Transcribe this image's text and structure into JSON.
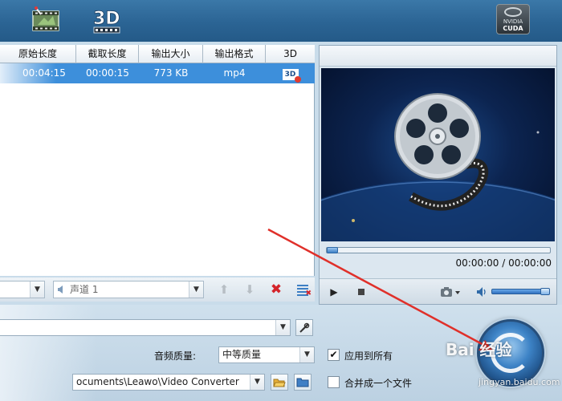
{
  "toolbar": {
    "edit_icon": "film-edit-icon",
    "threed_label": "3D",
    "nvidia": {
      "brand": "NVIDIA",
      "label": "CUDA"
    }
  },
  "file_list": {
    "columns": [
      "原始长度",
      "截取长度",
      "输出大小",
      "输出格式",
      "3D"
    ],
    "rows": [
      {
        "original_length": "00:04:15",
        "trim_length": "00:00:15",
        "output_size": "773 KB",
        "output_format": "mp4",
        "threed_icon": "3d-badge-icon"
      }
    ]
  },
  "list_tools": {
    "audio_track": "声道 1",
    "icons": [
      "move-up-icon",
      "move-down-icon",
      "delete-icon",
      "list-manage-icon"
    ]
  },
  "preview": {
    "timecode": "00:00:00 / 00:00:00",
    "progress": 0,
    "volume": 0.9,
    "icons": [
      "play-icon",
      "stop-icon",
      "camera-icon",
      "volume-icon"
    ]
  },
  "settings": {
    "audio_quality_label": "音频质量:",
    "audio_quality_value": "中等质量",
    "apply_all_label": "应用到所有",
    "apply_all_checked": true,
    "output_path": "ocuments\\Leawo\\Video Converter",
    "merge_label": "合并成一个文件",
    "merge_checked": false
  },
  "watermark": {
    "brand": "Bai  经验",
    "url": "jingyan.baidu.com"
  },
  "colors": {
    "toolbar": "#2b6494",
    "selection": "#3d8fdb",
    "annotation": "#e0302a"
  }
}
